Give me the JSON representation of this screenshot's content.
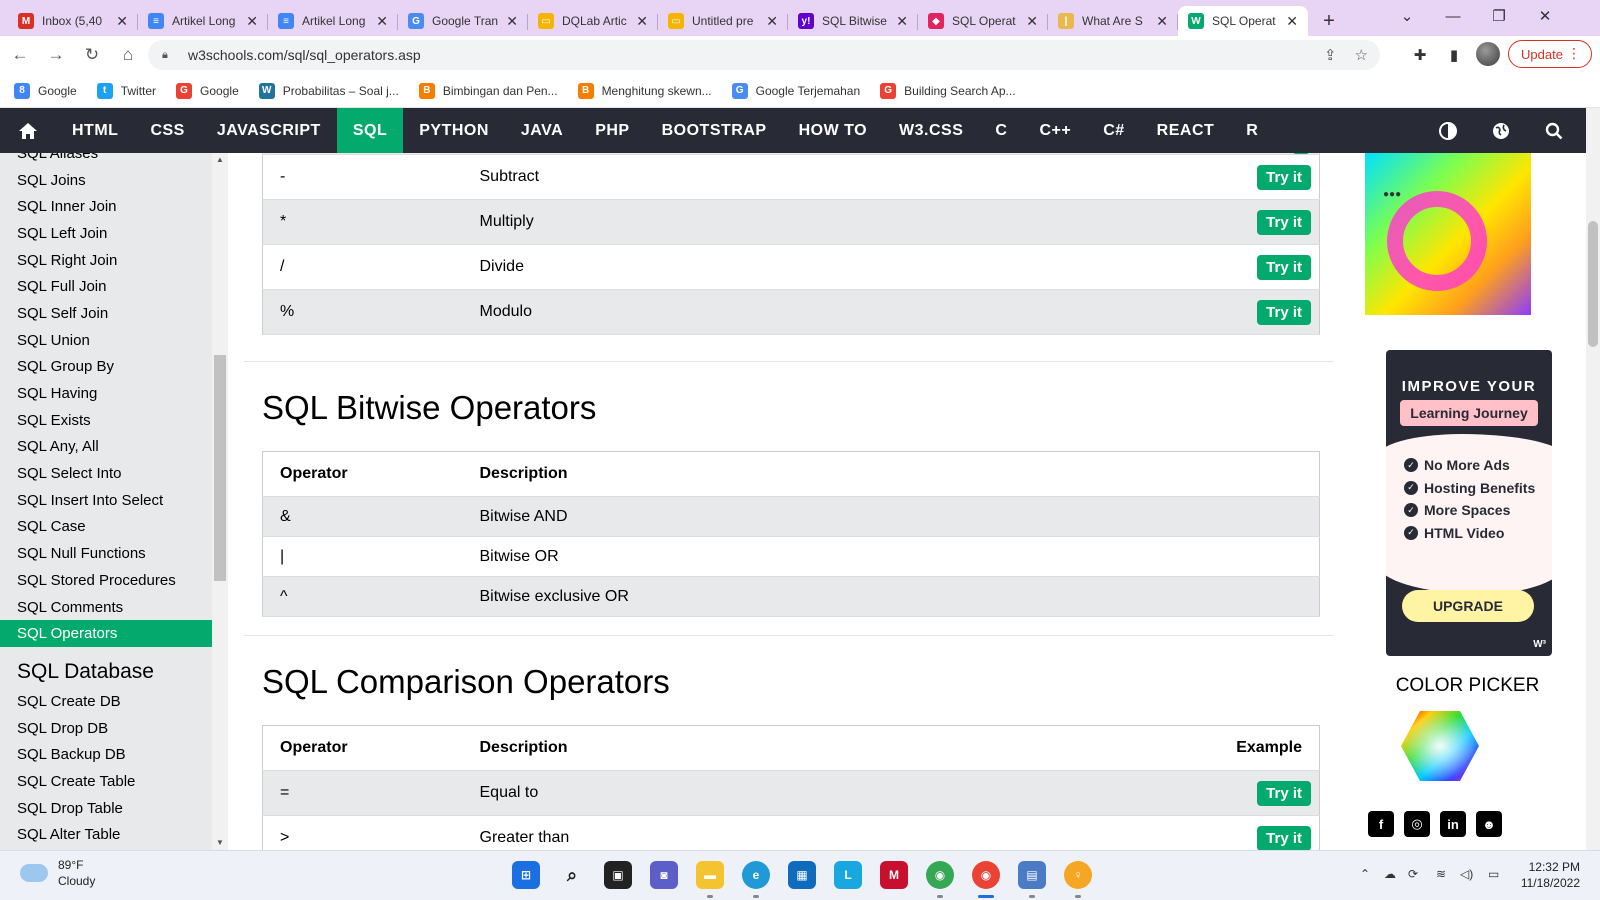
{
  "browser": {
    "tabs": [
      {
        "label": "Inbox (5,40",
        "icon": "gmail-icon",
        "color": "#d93025",
        "glyph": "M"
      },
      {
        "label": "Artikel Long",
        "icon": "docs-icon",
        "color": "#4285f4",
        "glyph": "≡"
      },
      {
        "label": "Artikel Long",
        "icon": "docs-icon",
        "color": "#4285f4",
        "glyph": "≡"
      },
      {
        "label": "Google Tran",
        "icon": "translate-icon",
        "color": "#4c8bf5",
        "glyph": "G"
      },
      {
        "label": "DQLab Artic",
        "icon": "slides-icon",
        "color": "#f4b400",
        "glyph": "▭"
      },
      {
        "label": "Untitled pre",
        "icon": "slides-icon",
        "color": "#f4b400",
        "glyph": "▭"
      },
      {
        "label": "SQL Bitwise",
        "icon": "yahoo-icon",
        "color": "#6001d2",
        "glyph": "y!"
      },
      {
        "label": "SQL Operat",
        "icon": "cube-icon",
        "color": "#e0245e",
        "glyph": "◆"
      },
      {
        "label": "What Are S",
        "icon": "bars-icon",
        "color": "#e9b94f",
        "glyph": "|"
      },
      {
        "label": "SQL Operat",
        "icon": "w3schools-icon",
        "color": "#04aa6d",
        "glyph": "W"
      }
    ],
    "active_tab": 9,
    "url": "w3schools.com/sql/sql_operators.asp",
    "update_label": "Update",
    "bookmarks": [
      {
        "label": "Google",
        "icon": "google-icon",
        "color": "#4285f4",
        "glyph": "8"
      },
      {
        "label": "Twitter",
        "icon": "twitter-icon",
        "color": "#1da1f2",
        "glyph": "t"
      },
      {
        "label": "Google",
        "icon": "google-icon",
        "color": "#ea4335",
        "glyph": "G"
      },
      {
        "label": "Probabilitas – Soal j...",
        "icon": "wordpress-icon",
        "color": "#21759b",
        "glyph": "W"
      },
      {
        "label": "Bimbingan dan Pen...",
        "icon": "blogger-icon",
        "color": "#f57d00",
        "glyph": "B"
      },
      {
        "label": "Menghitung skewn...",
        "icon": "blogger-icon",
        "color": "#f57d00",
        "glyph": "B"
      },
      {
        "label": "Google Terjemahan",
        "icon": "translate-icon",
        "color": "#4c8bf5",
        "glyph": "G"
      },
      {
        "label": "Building Search Ap...",
        "icon": "google-icon",
        "color": "#ea4335",
        "glyph": "G"
      }
    ]
  },
  "nav": {
    "items": [
      "HTML",
      "CSS",
      "JAVASCRIPT",
      "SQL",
      "PYTHON",
      "JAVA",
      "PHP",
      "BOOTSTRAP",
      "HOW TO",
      "W3.CSS",
      "C",
      "C++",
      "C#",
      "REACT",
      "R"
    ],
    "active": "SQL"
  },
  "sidebar": {
    "items": [
      "SQL Aliases",
      "SQL Joins",
      "SQL Inner Join",
      "SQL Left Join",
      "SQL Right Join",
      "SQL Full Join",
      "SQL Self Join",
      "SQL Union",
      "SQL Group By",
      "SQL Having",
      "SQL Exists",
      "SQL Any, All",
      "SQL Select Into",
      "SQL Insert Into Select",
      "SQL Case",
      "SQL Null Functions",
      "SQL Stored Procedures",
      "SQL Comments",
      "SQL Operators"
    ],
    "active": "SQL Operators",
    "section_heading": "SQL Database",
    "section_items": [
      "SQL Create DB",
      "SQL Drop DB",
      "SQL Backup DB",
      "SQL Create Table",
      "SQL Drop Table",
      "SQL Alter Table"
    ]
  },
  "main": {
    "arithmetic_rows": [
      {
        "op": "-",
        "desc": "Subtract",
        "try": "Try it"
      },
      {
        "op": "*",
        "desc": "Multiply",
        "try": "Try it"
      },
      {
        "op": "/",
        "desc": "Divide",
        "try": "Try it"
      },
      {
        "op": "%",
        "desc": "Modulo",
        "try": "Try it"
      }
    ],
    "bitwise": {
      "heading": "SQL Bitwise Operators",
      "col_operator": "Operator",
      "col_description": "Description",
      "rows": [
        {
          "op": "&",
          "desc": "Bitwise AND"
        },
        {
          "op": "|",
          "desc": "Bitwise OR"
        },
        {
          "op": "^",
          "desc": "Bitwise exclusive OR"
        }
      ]
    },
    "comparison": {
      "heading": "SQL Comparison Operators",
      "col_operator": "Operator",
      "col_description": "Description",
      "col_example": "Example",
      "rows": [
        {
          "op": "=",
          "desc": "Equal to",
          "try": "Try it"
        },
        {
          "op": ">",
          "desc": "Greater than",
          "try": "Try it"
        }
      ]
    }
  },
  "ads": {
    "title_line": "IMPROVE YOUR",
    "pill": "Learning Journey",
    "benefits": [
      "No More Ads",
      "Hosting Benefits",
      "More Spaces",
      "HTML Video"
    ],
    "button": "UPGRADE",
    "color_picker_title": "COLOR PICKER"
  },
  "taskbar": {
    "temperature": "89°F",
    "condition": "Cloudy",
    "time": "12:32 PM",
    "date": "11/18/2022"
  }
}
